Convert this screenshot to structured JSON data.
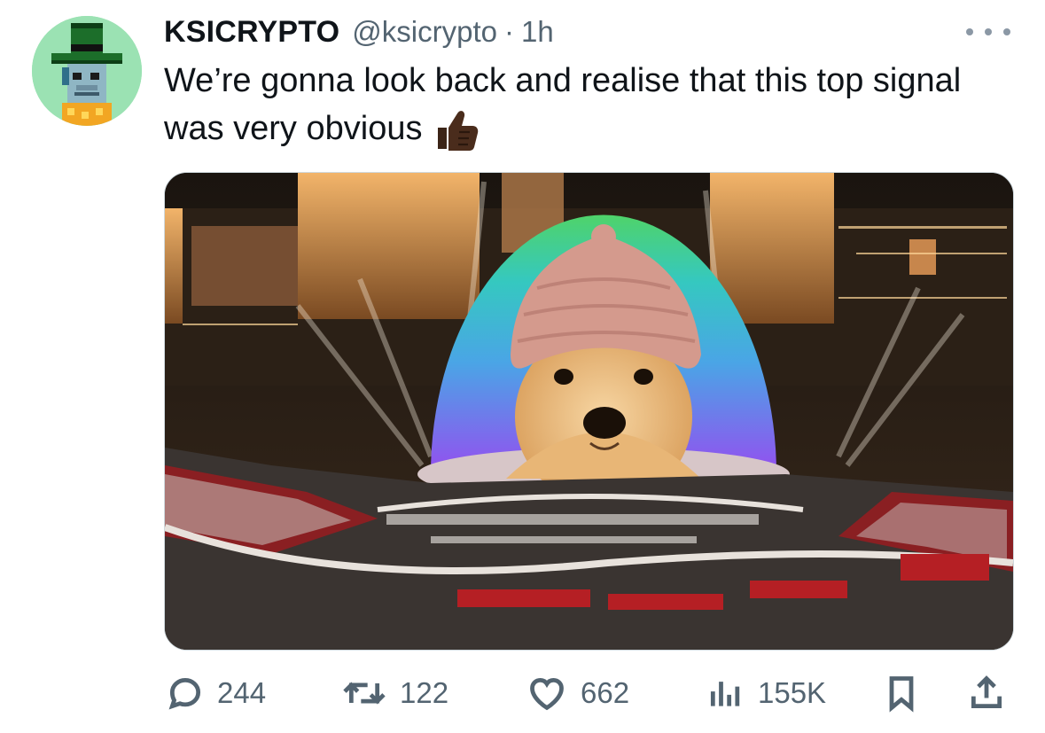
{
  "tweet": {
    "display_name": "KSICRYPTO",
    "handle": "@ksicrypto",
    "separator": "·",
    "time": "1h",
    "text": "We’re gonna look back and realise that this top signal was very obvious",
    "emoji": "thumbs-up-dark-skin"
  },
  "avatar": {
    "icon": "pixel-leprechaun-avatar",
    "background": "#9be2b3"
  },
  "media": {
    "description_icon": "las-vegas-sphere-dog-image"
  },
  "actions": {
    "replies": "244",
    "retweets": "122",
    "likes": "662",
    "views": "155K"
  },
  "colors": {
    "text": "#0f1419",
    "secondary": "#536471",
    "border": "#cfd9de"
  }
}
